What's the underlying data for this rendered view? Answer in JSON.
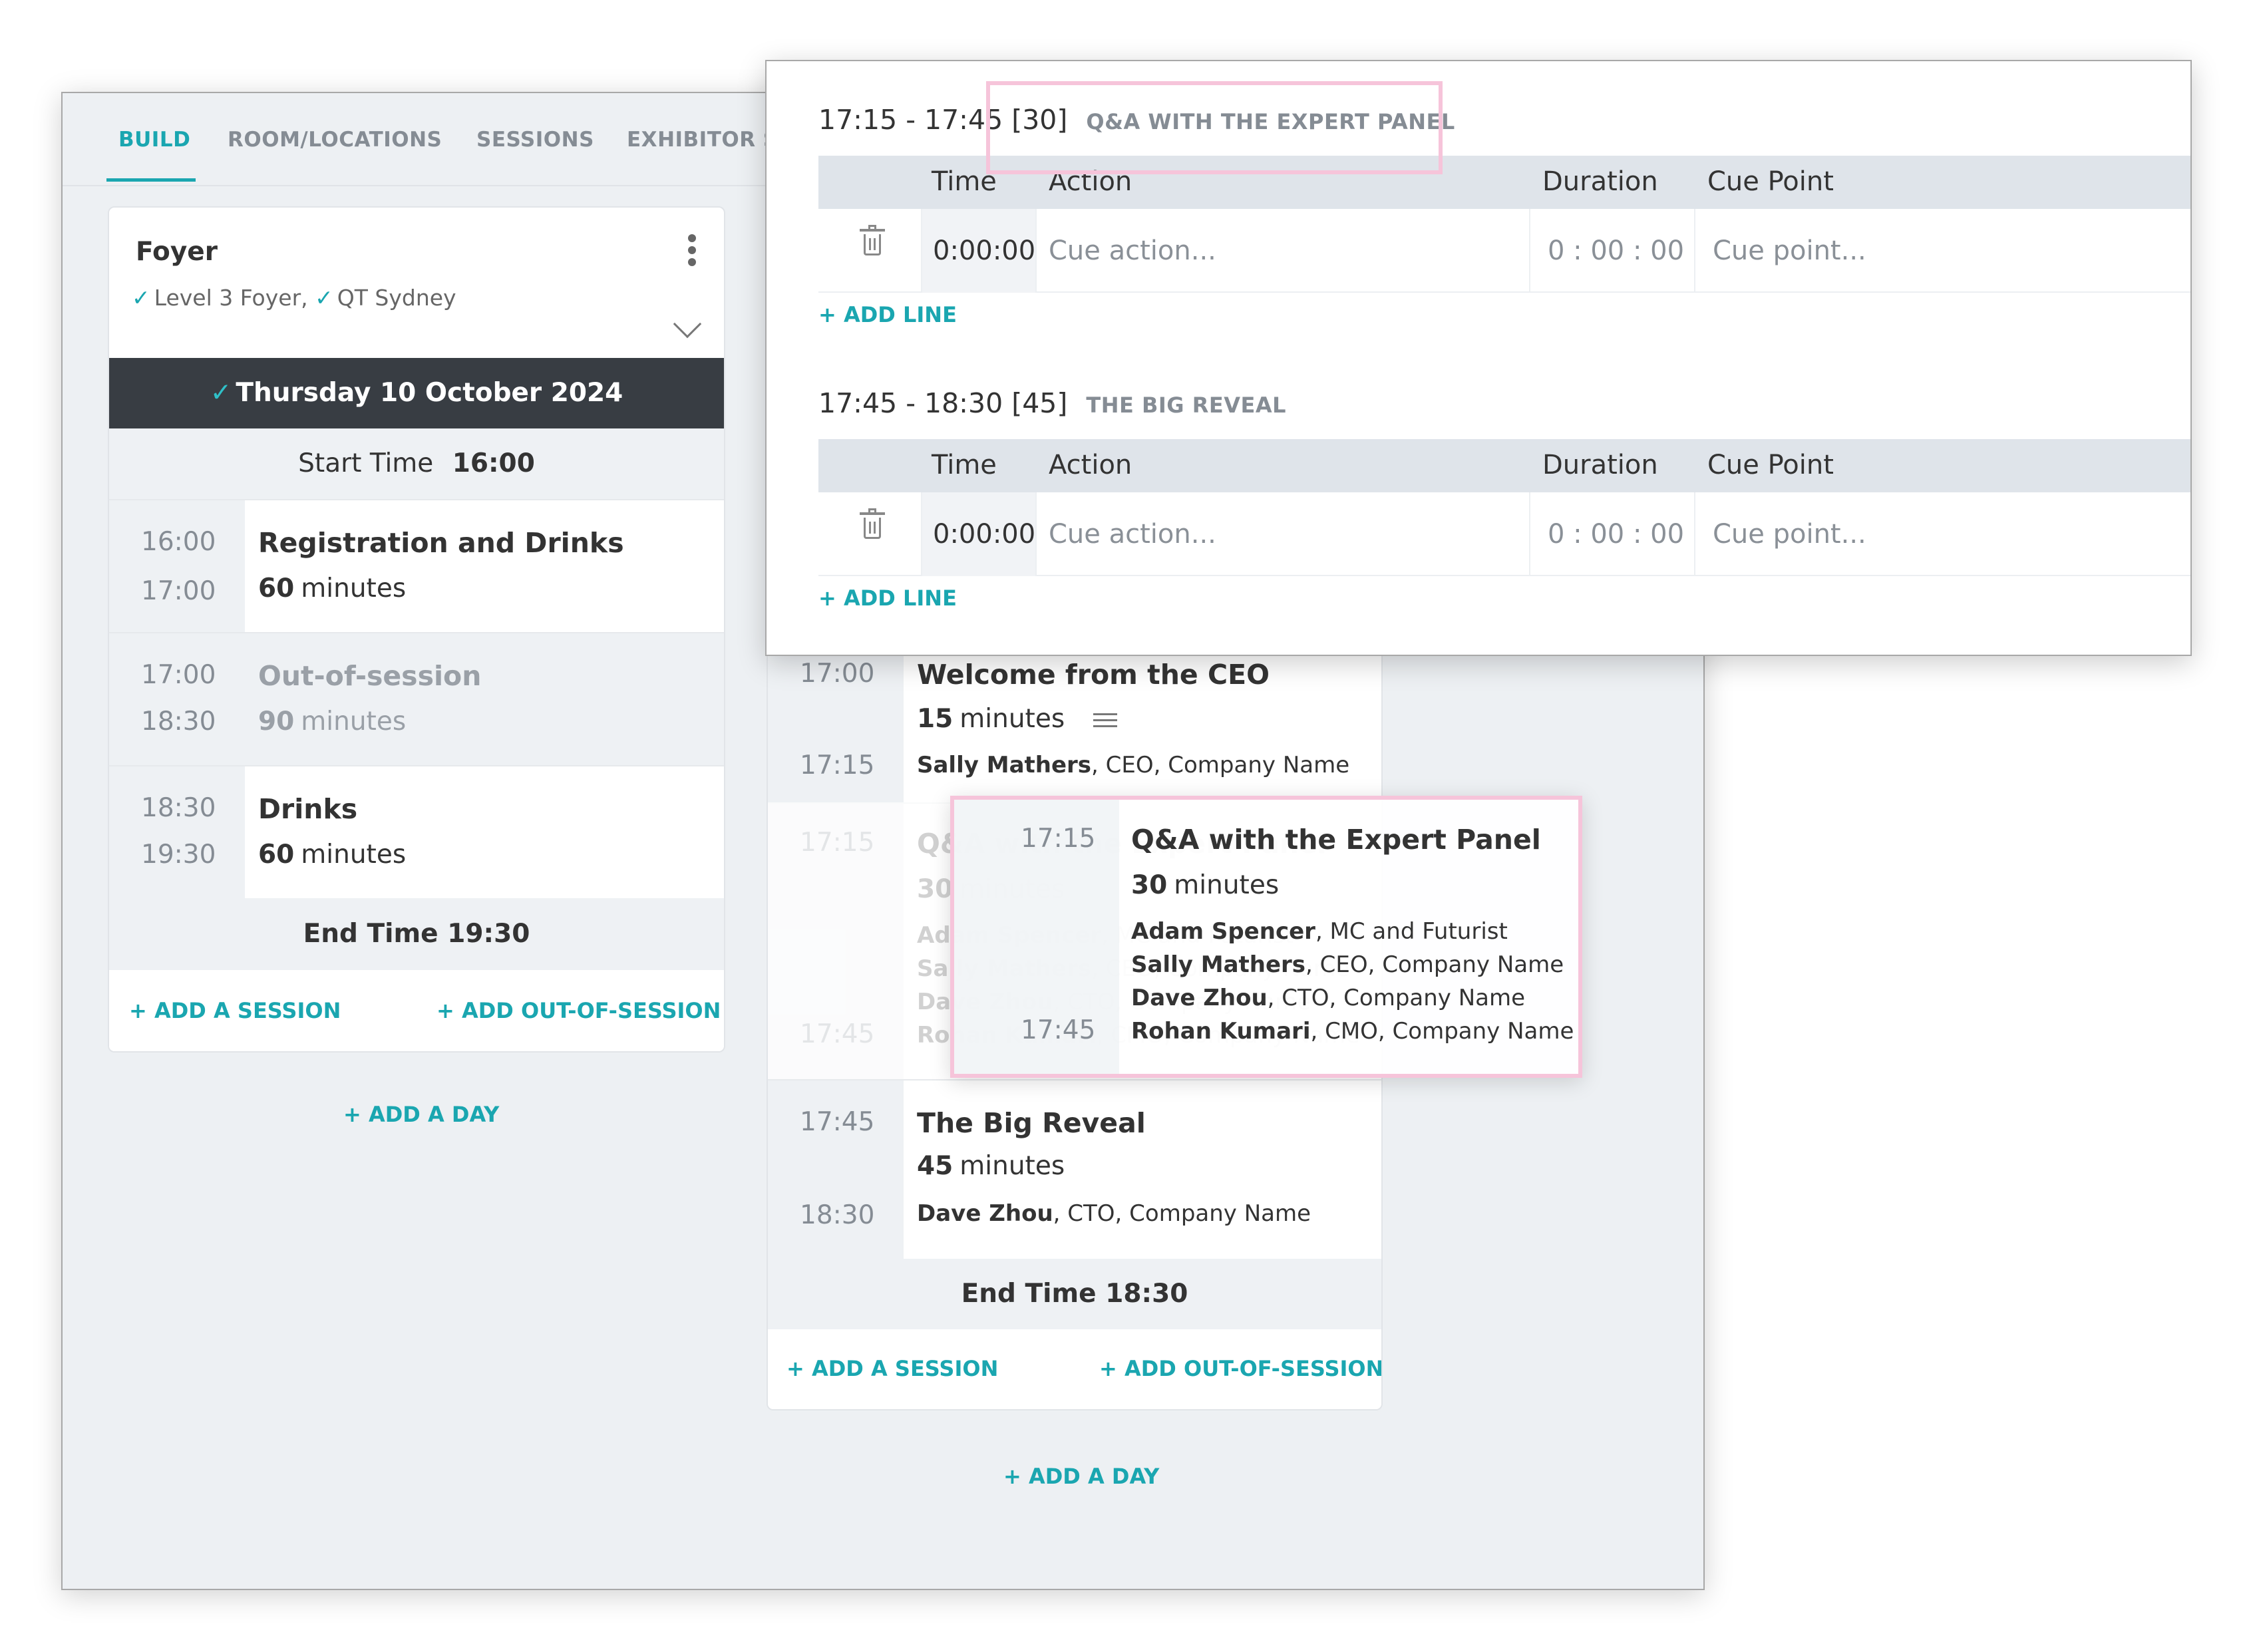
{
  "tabs": [
    "BUILD",
    "ROOM/LOCATIONS",
    "SESSIONS",
    "EXHIBITOR S"
  ],
  "room": {
    "name": "Foyer",
    "locations": [
      "Level 3 Foyer,",
      "QT Sydney"
    ]
  },
  "day": {
    "label": "Thursday 10 October 2024",
    "start_label": "Start Time",
    "start_time": "16:00",
    "end_label": "End Time 19:30"
  },
  "left_sessions": [
    {
      "start": "16:00",
      "end": "17:00",
      "title": "Registration and Drinks",
      "duration": "60",
      "unit": "minutes"
    },
    {
      "start": "17:00",
      "end": "18:30",
      "title": "Out-of-session",
      "duration": "90",
      "unit": "minutes"
    },
    {
      "start": "18:30",
      "end": "19:30",
      "title": "Drinks",
      "duration": "60",
      "unit": "minutes"
    }
  ],
  "links": {
    "add_session": "+ ADD A SESSION",
    "add_oos": "+ ADD OUT-OF-SESSION",
    "add_day": "+ ADD A DAY",
    "add_line": "+ ADD LINE"
  },
  "mid": {
    "s1": {
      "start": "17:00",
      "end": "17:15",
      "title": "Welcome from the CEO",
      "duration": "15",
      "unit": "minutes",
      "people": [
        {
          "name": "Sally Mathers",
          "role": ", CEO, Company Name"
        }
      ]
    },
    "s2": {
      "start": "17:15",
      "end": "17:45",
      "title": "Q&A with the Expert Panel",
      "duration": "30",
      "unit": "minutes",
      "people": [
        {
          "name": "Adam Spencer",
          "role": ", MC and Futurist"
        },
        {
          "name": "Sally Mathers",
          "role": ", CEO, Company Name"
        },
        {
          "name": "Dave Zhou",
          "role": ", CTO, Company Name"
        },
        {
          "name": "Rohan Kumari",
          "role": ", CMO, Company Name"
        }
      ]
    },
    "s3": {
      "start": "17:45",
      "end": "18:30",
      "title": "The Big Reveal",
      "duration": "45",
      "unit": "minutes",
      "people": [
        {
          "name": "Dave Zhou",
          "role": ", CTO, Company Name"
        }
      ]
    },
    "end_label": "End Time 18:30"
  },
  "popup": {
    "sections": [
      {
        "range": "17:15 - 17:45 [30]",
        "caption": "Q&A WITH THE EXPERT PANEL"
      },
      {
        "range": "17:45 - 18:30 [45]",
        "caption": "THE BIG REVEAL"
      }
    ],
    "columns": [
      "Time",
      "Action",
      "Duration",
      "Cue Point"
    ],
    "row": {
      "time": "0:00:00",
      "action_placeholder": "Cue action...",
      "duration": "0 : 00 : 00",
      "cue_placeholder": "Cue point..."
    }
  },
  "colors": {
    "accent": "#1aa6b0",
    "dark_bar": "#383d43",
    "highlight": "#f6c4da",
    "background": "#edf0f3"
  }
}
